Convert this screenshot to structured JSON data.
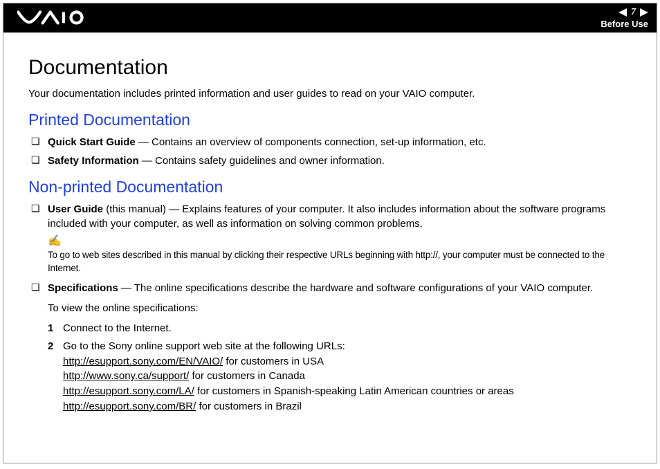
{
  "header": {
    "page_number": "7",
    "section": "Before Use"
  },
  "title": "Documentation",
  "intro": "Your documentation includes printed information and user guides to read on your VAIO computer.",
  "printed": {
    "heading": "Printed Documentation",
    "items": [
      {
        "label": "Quick Start Guide",
        "desc": " — Contains an overview of components connection, set-up information, etc."
      },
      {
        "label": "Safety Information",
        "desc": " — Contains safety guidelines and owner information."
      }
    ]
  },
  "nonprinted": {
    "heading": "Non-printed Documentation",
    "user_guide": {
      "label": "User Guide",
      "suffix": " (this manual) — Explains features of your computer. It also includes information about the software programs included with your computer, as well as information on solving common problems."
    },
    "note_icon": "✍",
    "note": "To go to web sites described in this manual by clicking their respective URLs beginning with http://, your computer must be connected to the Internet.",
    "specs": {
      "label": "Specifications",
      "desc": " — The online specifications describe the hardware and software configurations of your VAIO computer.",
      "view_intro": "To view the online specifications:",
      "steps": {
        "s1": "Connect to the Internet.",
        "s2_intro": "Go to the Sony online support web site at the following URLs:",
        "links": [
          {
            "url": "http://esupport.sony.com/EN/VAIO/",
            "tail": " for customers in USA"
          },
          {
            "url": "http://www.sony.ca/support/",
            "tail": " for customers in Canada"
          },
          {
            "url": "http://esupport.sony.com/LA/",
            "tail": " for customers in Spanish-speaking Latin American countries or areas"
          },
          {
            "url": "http://esupport.sony.com/BR/",
            "tail": " for customers in Brazil"
          }
        ]
      }
    }
  }
}
